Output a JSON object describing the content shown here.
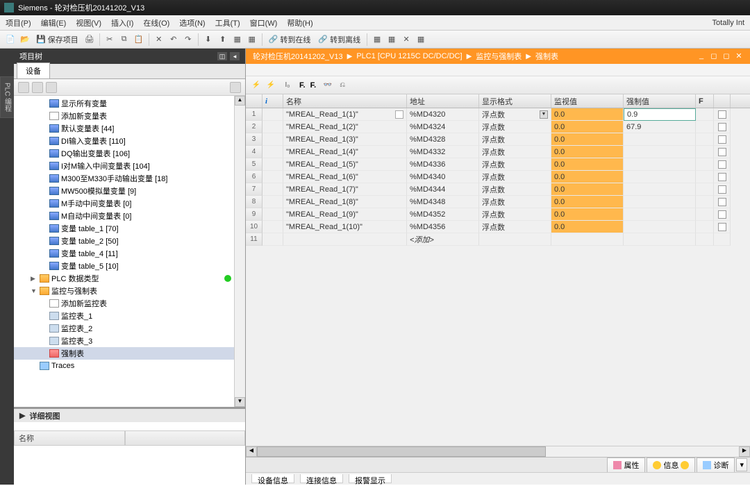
{
  "title": "Siemens - 轮对检压机20141202_V13",
  "menu": [
    "项目(P)",
    "编辑(E)",
    "视图(V)",
    "插入(I)",
    "在线(O)",
    "选项(N)",
    "工具(T)",
    "窗口(W)",
    "帮助(H)"
  ],
  "menuRight": "Totally Int",
  "toolbar": {
    "save": "保存项目",
    "goOnline": "转到在线",
    "goOffline": "转到离线"
  },
  "sideTab": "PLC 编程",
  "projectTree": {
    "title": "项目树",
    "tab": "设备",
    "items": [
      {
        "icon": "ic-table",
        "label": "显示所有变量",
        "lvl": 1
      },
      {
        "icon": "ic-add",
        "label": "添加新变量表",
        "lvl": 1
      },
      {
        "icon": "ic-table",
        "label": "默认变量表 [44]",
        "lvl": 1
      },
      {
        "icon": "ic-table",
        "label": "DI输入变量表 [110]",
        "lvl": 1
      },
      {
        "icon": "ic-table",
        "label": "DQ输出变量表 [106]",
        "lvl": 1
      },
      {
        "icon": "ic-table",
        "label": "I对M输入中间变量表 [104]",
        "lvl": 1
      },
      {
        "icon": "ic-table",
        "label": "M300至M330手动输出变量 [18]",
        "lvl": 1
      },
      {
        "icon": "ic-table",
        "label": "MW500模拟量变量 [9]",
        "lvl": 1
      },
      {
        "icon": "ic-table",
        "label": "M手动中间变量表 [0]",
        "lvl": 1
      },
      {
        "icon": "ic-table",
        "label": "M自动中间变量表 [0]",
        "lvl": 1
      },
      {
        "icon": "ic-table",
        "label": "变量 table_1 [70]",
        "lvl": 1
      },
      {
        "icon": "ic-table",
        "label": "变量 table_2 [50]",
        "lvl": 1
      },
      {
        "icon": "ic-table",
        "label": "变量 table_4 [11]",
        "lvl": 1
      },
      {
        "icon": "ic-table",
        "label": "变量 table_5 [10]",
        "lvl": 1
      },
      {
        "icon": "ic-folder",
        "label": "PLC 数据类型",
        "lvl": 0,
        "exp": "▶",
        "dot": true
      },
      {
        "icon": "ic-folder",
        "label": "监控与强制表",
        "lvl": 0,
        "exp": "▼"
      },
      {
        "icon": "ic-add",
        "label": "添加新监控表",
        "lvl": 1
      },
      {
        "icon": "ic-watch",
        "label": "监控表_1",
        "lvl": 1
      },
      {
        "icon": "ic-watch",
        "label": "监控表_2",
        "lvl": 1
      },
      {
        "icon": "ic-watch",
        "label": "监控表_3",
        "lvl": 1
      },
      {
        "icon": "ic-force",
        "label": "强制表",
        "lvl": 1,
        "sel": true
      },
      {
        "icon": "ic-trace",
        "label": "Traces",
        "lvl": 0
      }
    ]
  },
  "detailView": {
    "title": "详细视图",
    "col": "名称"
  },
  "breadcrumb": [
    "轮对检压机20141202_V13",
    "PLC1 [CPU 1215C DC/DC/DC]",
    "监控与强制表",
    "强制表"
  ],
  "gridToolbar": {
    "f1": "F.",
    "f2": "F."
  },
  "columns": {
    "i": "i",
    "name": "名称",
    "addr": "地址",
    "fmt": "显示格式",
    "mon": "监视值",
    "force": "强制值",
    "f": "F"
  },
  "rows": [
    {
      "n": "1",
      "name": "\"MREAL_Read_1(1)\"",
      "addr": "%MD4320",
      "fmt": "浮点数",
      "mon": "0.0",
      "force": "0.9",
      "dd": true,
      "ic": true
    },
    {
      "n": "2",
      "name": "\"MREAL_Read_1(2)\"",
      "addr": "%MD4324",
      "fmt": "浮点数",
      "mon": "0.0",
      "force": "67.9"
    },
    {
      "n": "3",
      "name": "\"MREAL_Read_1(3)\"",
      "addr": "%MD4328",
      "fmt": "浮点数",
      "mon": "0.0",
      "force": ""
    },
    {
      "n": "4",
      "name": "\"MREAL_Read_1(4)\"",
      "addr": "%MD4332",
      "fmt": "浮点数",
      "mon": "0.0",
      "force": ""
    },
    {
      "n": "5",
      "name": "\"MREAL_Read_1(5)\"",
      "addr": "%MD4336",
      "fmt": "浮点数",
      "mon": "0.0",
      "force": ""
    },
    {
      "n": "6",
      "name": "\"MREAL_Read_1(6)\"",
      "addr": "%MD4340",
      "fmt": "浮点数",
      "mon": "0.0",
      "force": ""
    },
    {
      "n": "7",
      "name": "\"MREAL_Read_1(7)\"",
      "addr": "%MD4344",
      "fmt": "浮点数",
      "mon": "0.0",
      "force": ""
    },
    {
      "n": "8",
      "name": "\"MREAL_Read_1(8)\"",
      "addr": "%MD4348",
      "fmt": "浮点数",
      "mon": "0.0",
      "force": ""
    },
    {
      "n": "9",
      "name": "\"MREAL_Read_1(9)\"",
      "addr": "%MD4352",
      "fmt": "浮点数",
      "mon": "0.0",
      "force": ""
    },
    {
      "n": "10",
      "name": "\"MREAL_Read_1(10)\"",
      "addr": "%MD4356",
      "fmt": "浮点数",
      "mon": "0.0",
      "force": ""
    }
  ],
  "addRow": {
    "n": "11",
    "placeholder": "<添加>"
  },
  "bottomTabs": {
    "prop": "属性",
    "info": "信息",
    "diag": "诊断"
  },
  "bottomSub": [
    "设备信息",
    "连接信息",
    "报警显示"
  ]
}
